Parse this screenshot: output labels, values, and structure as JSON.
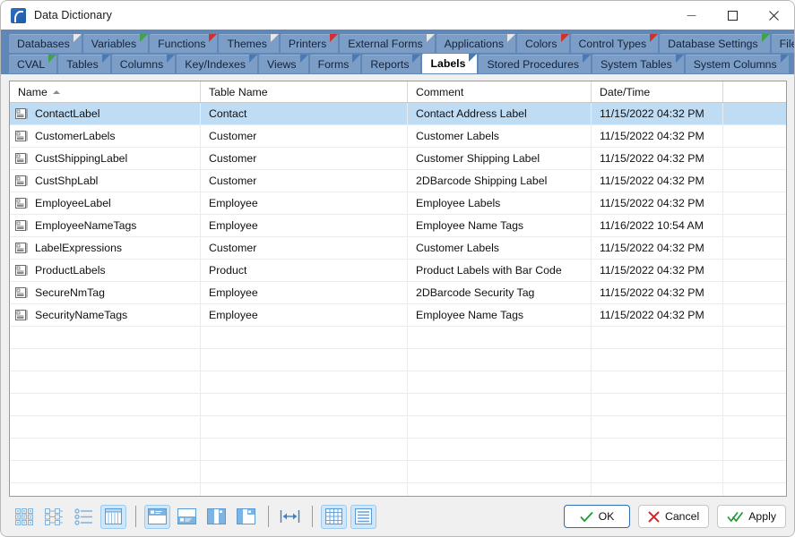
{
  "window": {
    "title": "Data Dictionary",
    "app_icon": "app-icon",
    "controls": {
      "minimize": "minimize-icon",
      "maximize": "maximize-icon",
      "close": "close-icon"
    }
  },
  "tabs": {
    "row1": [
      {
        "label": "Databases",
        "corner": "#e8e8e8",
        "active": false
      },
      {
        "label": "Variables",
        "corner": "#3fa34d",
        "active": false
      },
      {
        "label": "Functions",
        "corner": "#d13030",
        "active": false
      },
      {
        "label": "Themes",
        "corner": "#e8e8e8",
        "active": false
      },
      {
        "label": "Printers",
        "corner": "#d13030",
        "active": false
      },
      {
        "label": "External Forms",
        "corner": "#e8e8e8",
        "active": false
      },
      {
        "label": "Applications",
        "corner": "#e8e8e8",
        "active": false
      },
      {
        "label": "Colors",
        "corner": "#d13030",
        "active": false
      },
      {
        "label": "Control Types",
        "corner": "#d13030",
        "active": false
      },
      {
        "label": "Database Settings",
        "corner": "#3fa34d",
        "active": false
      },
      {
        "label": "Files",
        "corner": "#e8e8e8",
        "active": false
      }
    ],
    "row2": [
      {
        "label": "CVAL",
        "corner": "#3fa34d",
        "active": false
      },
      {
        "label": "Tables",
        "corner": "#4a79b5",
        "active": false
      },
      {
        "label": "Columns",
        "corner": "#4a79b5",
        "active": false
      },
      {
        "label": "Key/Indexes",
        "corner": "#4a79b5",
        "active": false
      },
      {
        "label": "Views",
        "corner": "#4a79b5",
        "active": false
      },
      {
        "label": "Forms",
        "corner": "#4a79b5",
        "active": false
      },
      {
        "label": "Reports",
        "corner": "#4a79b5",
        "active": false
      },
      {
        "label": "Labels",
        "corner": "#4a79b5",
        "active": true
      },
      {
        "label": "Stored Procedures",
        "corner": "#4a79b5",
        "active": false
      },
      {
        "label": "System Tables",
        "corner": "#4a79b5",
        "active": false
      },
      {
        "label": "System Columns",
        "corner": "#4a79b5",
        "active": false
      }
    ],
    "overflow_icon": "chevron-down-icon"
  },
  "grid": {
    "columns": [
      {
        "key": "name",
        "label": "Name",
        "sort": "asc"
      },
      {
        "key": "table_name",
        "label": "Table Name",
        "sort": ""
      },
      {
        "key": "comment",
        "label": "Comment",
        "sort": ""
      },
      {
        "key": "datetime",
        "label": "Date/Time",
        "sort": ""
      }
    ],
    "row_icon": "label-record-icon",
    "rows": [
      {
        "name": "ContactLabel",
        "table_name": "Contact",
        "comment": "Contact Address Label",
        "datetime": "11/15/2022 04:32 PM",
        "selected": true
      },
      {
        "name": "CustomerLabels",
        "table_name": "Customer",
        "comment": "Customer Labels",
        "datetime": "11/15/2022 04:32 PM",
        "selected": false
      },
      {
        "name": "CustShippingLabel",
        "table_name": "Customer",
        "comment": "Customer Shipping Label",
        "datetime": "11/15/2022 04:32 PM",
        "selected": false
      },
      {
        "name": "CustShpLabl",
        "table_name": "Customer",
        "comment": "2DBarcode Shipping Label",
        "datetime": "11/15/2022 04:32 PM",
        "selected": false
      },
      {
        "name": "EmployeeLabel",
        "table_name": "Employee",
        "comment": "Employee Labels",
        "datetime": "11/15/2022 04:32 PM",
        "selected": false
      },
      {
        "name": "EmployeeNameTags",
        "table_name": "Employee",
        "comment": "Employee Name Tags",
        "datetime": "11/16/2022 10:54 AM",
        "selected": false
      },
      {
        "name": "LabelExpressions",
        "table_name": "Customer",
        "comment": "Customer Labels",
        "datetime": "11/15/2022 04:32 PM",
        "selected": false
      },
      {
        "name": "ProductLabels",
        "table_name": "Product",
        "comment": "Product Labels with Bar Code",
        "datetime": "11/15/2022 04:32 PM",
        "selected": false
      },
      {
        "name": "SecureNmTag",
        "table_name": "Employee",
        "comment": "2DBarcode Security Tag",
        "datetime": "11/15/2022 04:32 PM",
        "selected": false
      },
      {
        "name": "SecurityNameTags",
        "table_name": "Employee",
        "comment": "Employee Name Tags",
        "datetime": "11/15/2022 04:32 PM",
        "selected": false
      }
    ],
    "empty_row_count": 8
  },
  "toolbar": {
    "buttons": [
      {
        "name": "large-icons-view-button",
        "icon": "large-icons-icon",
        "active": false
      },
      {
        "name": "tree-view-button",
        "icon": "tree-list-icon",
        "active": false
      },
      {
        "name": "detail-list-view-button",
        "icon": "bullet-list-icon",
        "active": false
      },
      {
        "name": "grid-view-button",
        "icon": "table-grid-icon",
        "active": true
      }
    ],
    "layout_buttons": [
      {
        "name": "layout-top-panel-button",
        "icon": "layout-top-icon",
        "active": true
      },
      {
        "name": "layout-bottom-panel-button",
        "icon": "layout-bottom-icon",
        "active": false
      },
      {
        "name": "layout-left-panel-button",
        "icon": "layout-left-icon",
        "active": false
      },
      {
        "name": "layout-right-panel-button",
        "icon": "layout-right-icon",
        "active": false
      }
    ],
    "fit_button": {
      "name": "fit-columns-button",
      "icon": "fit-width-icon",
      "active": false
    },
    "density_buttons": [
      {
        "name": "grid-lines-button",
        "icon": "grid-lines-icon",
        "active": true
      },
      {
        "name": "row-lines-button",
        "icon": "row-lines-icon",
        "active": true
      }
    ]
  },
  "dialog_buttons": {
    "ok": {
      "label": "OK",
      "icon": "check-icon",
      "color": "#1f9c35"
    },
    "cancel": {
      "label": "Cancel",
      "icon": "x-icon",
      "color": "#d62a2a"
    },
    "apply": {
      "label": "Apply",
      "icon": "double-check-icon",
      "color": "#1f9c35"
    }
  },
  "colors": {
    "tabstrip": "#5f87b8",
    "tab": "#7b9dc6",
    "selection": "#bfdcf5",
    "toolbar_active": "#cfe6fb"
  }
}
